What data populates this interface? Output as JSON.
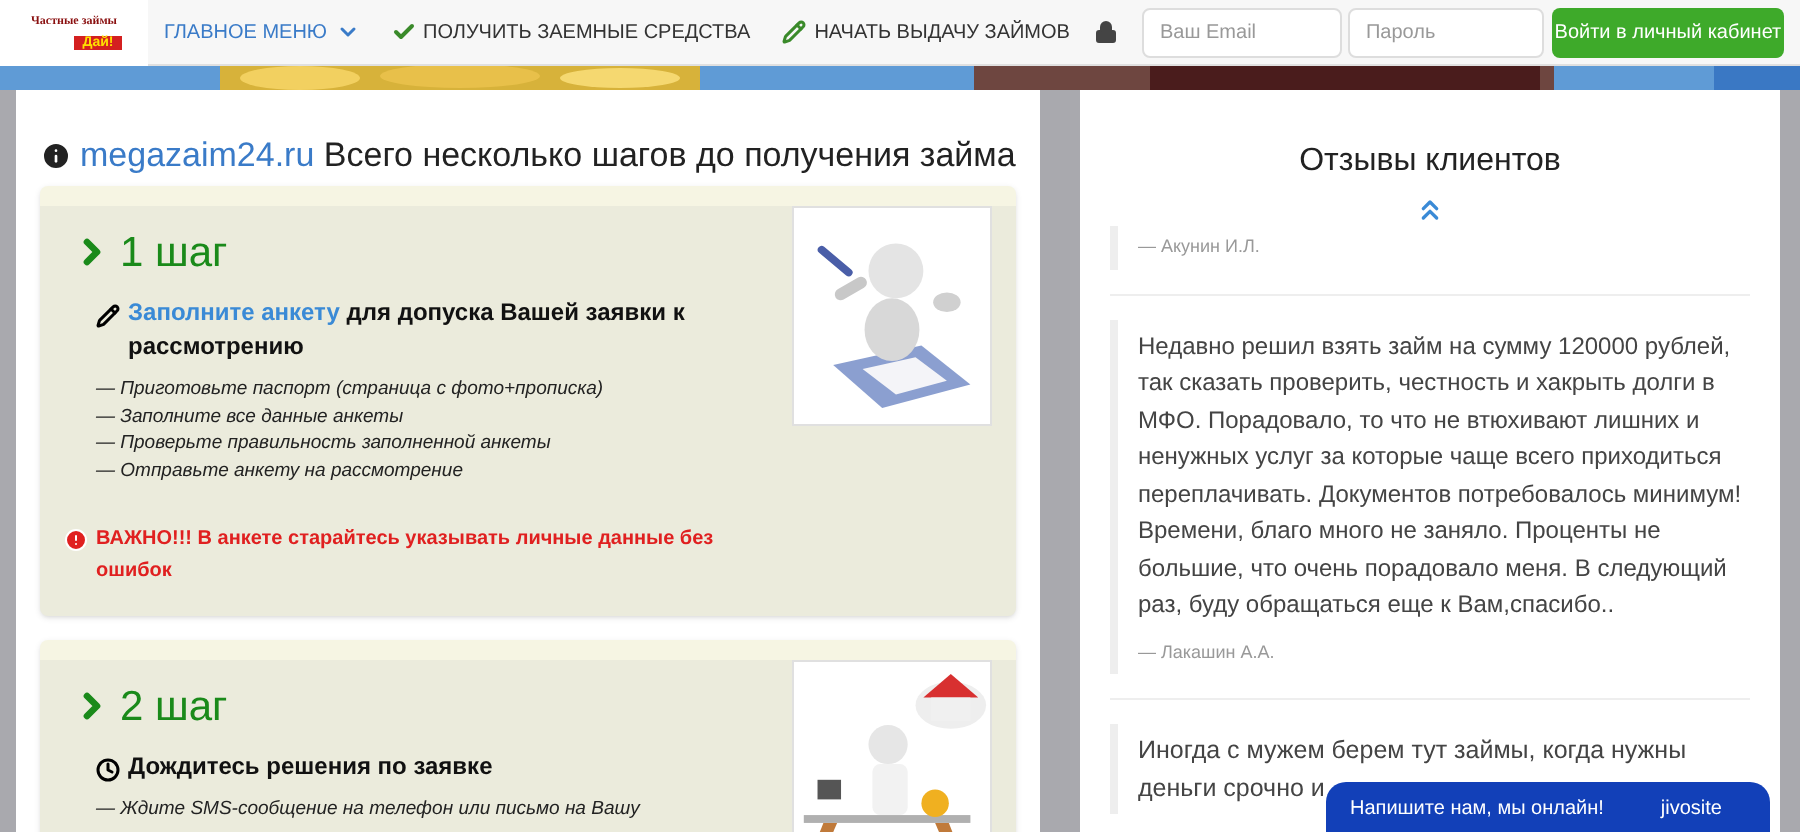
{
  "header": {
    "logo": {
      "title": "Частные займы",
      "badge": "Дай!"
    },
    "nav": [
      {
        "label": "ГЛАВНОЕ МЕНЮ",
        "kind": "dropdown"
      },
      {
        "label": "ПОЛУЧИТЬ ЗАЕМНЫЕ СРЕДСТВА",
        "kind": "check"
      },
      {
        "label": "НАЧАТЬ ВЫДАЧУ ЗАЙМОВ",
        "kind": "pencil"
      }
    ],
    "login": {
      "email_placeholder": "Ваш Email",
      "password_placeholder": "Пароль",
      "button": "Войти в личный кабинет"
    }
  },
  "steps_panel": {
    "site": "megazaim24.ru",
    "title": "Всего несколько шагов до получения займа",
    "steps": [
      {
        "title": "1 шаг",
        "link": "Заполните анкету",
        "heading": "для допуска Вашей заявки к рассмотрению",
        "items": [
          "— Приготовьте паспорт (страница с фото+прописка)",
          "— Заполните все данные анкеты",
          "— Проверьте правильность заполненной анкеты",
          "— Отправьте анкету на рассмотрение"
        ],
        "warning": "ВАЖНО!!! В анкете старайтесь указывать личные данные без ошибок"
      },
      {
        "title": "2 шаг",
        "heading": "Дождитесь решения по заявке",
        "items": [
          "— Ждите SMS-сообщение на телефон или письмо на Вашу"
        ]
      }
    ]
  },
  "reviews_panel": {
    "title": "Отзывы клиентов",
    "reviews": [
      {
        "author": "— Акунин И.Л."
      },
      {
        "text": "Недавно решил взять займ на сумму 120000 рублей, так сказать проверить, честность и хакрыть долги в МФО. Порадовало, то что не втюхивают лишних и ненужных услуг за которые чаще всего приходиться переплачивать. Документов потребовалось минимум! Времени, благо много не заняло. Проценты не большие, что очень порадовало меня. В следующий раз, буду обращаться еще к Вам,спасибо..",
        "author": "— Лакашин А.А."
      },
      {
        "lines": [
          "Иногда с мужем берем тут займы, когда нужны",
          "деньги срочно и"
        ]
      }
    ]
  },
  "chat_widget": {
    "text": "Напишите нам, мы онлайн!",
    "brand": "jivosite"
  }
}
